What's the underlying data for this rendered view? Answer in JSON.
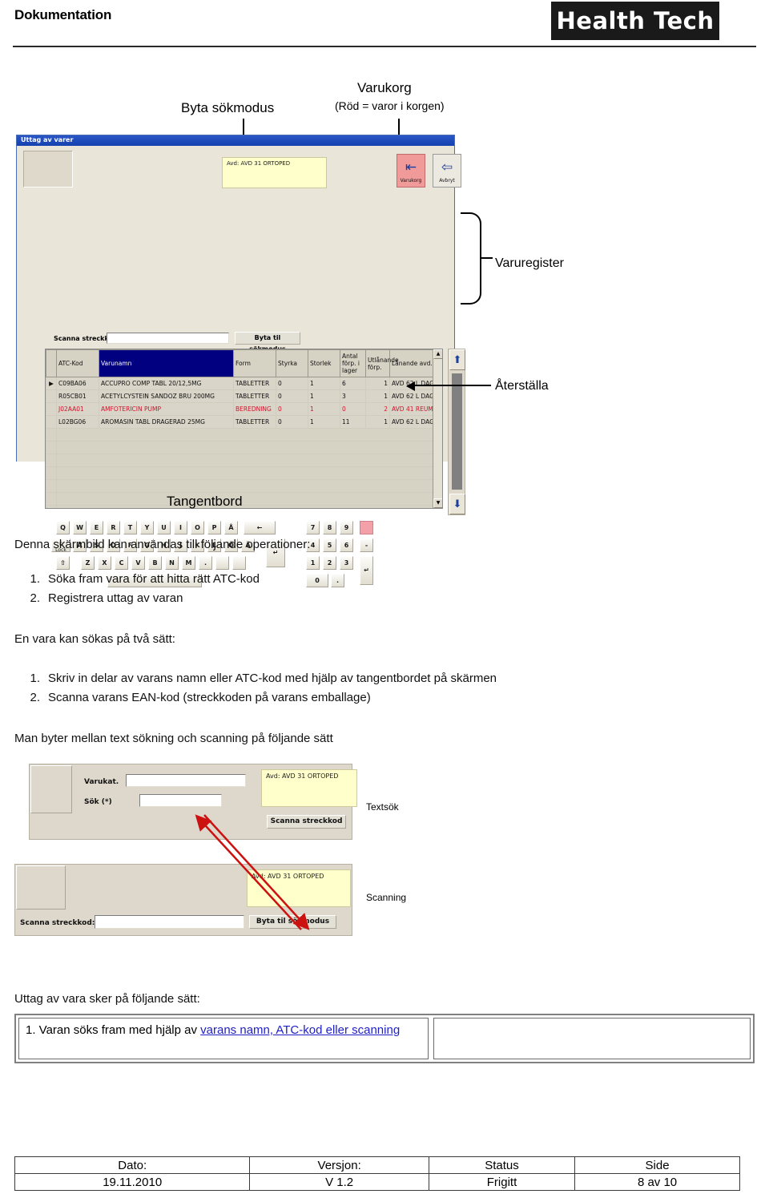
{
  "header": {
    "doc_title": "Dokumentation",
    "logo_text": "Health Tech"
  },
  "callouts": {
    "byta_sokmodus": "Byta sökmodus",
    "varukorg_line1": "Varukorg",
    "varukorg_line2": "(Röd = varor i korgen)",
    "varuregister": "Varuregister",
    "aterstalla": "Återställa",
    "tangentbord": "Tangentbord",
    "textsok": "Textsök",
    "scanning": "Scanning"
  },
  "app": {
    "window_title": "Uttag av varer",
    "avd_box": "Avd: AVD 31 ORTOPED",
    "toolbar": [
      {
        "label": "Varukorg",
        "glyph": "⇤",
        "highlight_color": "#f09a9a"
      },
      {
        "label": "Avbryt",
        "glyph": "⇦",
        "highlight_color": "#ece9e0"
      }
    ],
    "scan_label": "Scanna streckkod:",
    "scan_value": "",
    "switch_mode_button": "Byta til sökmodus",
    "grid": {
      "columns": [
        "",
        "ATC-Kod",
        "Varunamn",
        "Form",
        "Styrka",
        "Storlek",
        "Antal förp. i lager",
        "Utlånande förp.",
        "Lånande avd."
      ],
      "selected_column": "Varunamn",
      "rows": [
        {
          "marker": "▶",
          "atc": "C09BA06",
          "namn": "ACCUPRO COMP TABL 20/12,5MG",
          "form": "TABLETTER",
          "styrka": "0",
          "storlek": "1",
          "antal": "6",
          "utlan": "1",
          "avd": "AVD 62 L DAG",
          "red": false
        },
        {
          "marker": "",
          "atc": "R05CB01",
          "namn": "ACETYLCYSTEIN SANDOZ BRU 200MG",
          "form": "TABLETTER",
          "styrka": "0",
          "storlek": "1",
          "antal": "3",
          "utlan": "1",
          "avd": "AVD 62 L DAG",
          "red": false
        },
        {
          "marker": "",
          "atc": "J02AA01",
          "namn": "AMFOTERICIN PUMP",
          "form": "BEREDNING",
          "styrka": "0",
          "storlek": "1",
          "antal": "0",
          "utlan": "2",
          "avd": "AVD 41 REUM",
          "red": true
        },
        {
          "marker": "",
          "atc": "L02BG06",
          "namn": "AROMASIN TABL DRAGERAD 25MG",
          "form": "TABLETTER",
          "styrka": "0",
          "storlek": "1",
          "antal": "11",
          "utlan": "1",
          "avd": "AVD 62 L DAG",
          "red": false
        }
      ]
    },
    "keyboard": {
      "row1": [
        "Q",
        "W",
        "E",
        "R",
        "T",
        "Y",
        "U",
        "I",
        "O",
        "P",
        "Å"
      ],
      "backspace": "←",
      "row2_lock": "Lock",
      "row2": [
        "A",
        "S",
        "D",
        "F",
        "G",
        "H",
        "J",
        "K",
        "L",
        "Ö",
        "Ä"
      ],
      "enter": "↵",
      "row3_shift": "⇧",
      "row3": [
        "Z",
        "X",
        "C",
        "V",
        "B",
        "N",
        "M",
        ".",
        "",
        ""
      ],
      "space": "",
      "numpad_row1": [
        "7",
        "8",
        "9"
      ],
      "numpad_row2": [
        "4",
        "5",
        "6"
      ],
      "numpad_row3": [
        "1",
        "2",
        "3"
      ],
      "numpad_row4": [
        "0",
        "."
      ],
      "numpad_reset": "",
      "numpad_minus": "-",
      "numpad_enter": "↵",
      "reset_key_color": "#f4a0a8"
    }
  },
  "body": {
    "intro": "Denna skärmbild kan användas till följande operationer:",
    "list1": [
      {
        "num": "1.",
        "text": "Söka fram vara för att hitta rätt ATC-kod"
      },
      {
        "num": "2.",
        "text": "Registrera uttag av varan"
      }
    ],
    "search_intro": "En vara kan sökas på två sätt:",
    "list2": [
      {
        "num": "1.",
        "text": "Skriv in delar av varans namn eller ATC-kod med hjälp av tangentbordet på skärmen"
      },
      {
        "num": "2.",
        "text": "Scanna varans EAN-kod (streckkoden på varans emballage)"
      }
    ],
    "switch_intro": "Man byter mellan text sökning och scanning på följande sätt",
    "uttag_intro": "Uttag av vara sker på följande sätt:"
  },
  "panel_textsok": {
    "varukat_label": "Varukat.",
    "varukat_value": "",
    "sok_label": "Sök (*)",
    "sok_value": "",
    "avd_box": "Avd: AVD 31 ORTOPED",
    "scan_button": "Scanna streckkod"
  },
  "panel_scanning": {
    "scan_label": "Scanna streckkod:",
    "scan_value": "",
    "avd_box": "Avd: AVD 31 ORTOPED",
    "switch_button": "Byta til sökmodus"
  },
  "content_table": {
    "left_text_before": "1. Varan söks fram med hjälp av ",
    "left_link": "varans namn, ATC-kod eller scanning",
    "right_text": ""
  },
  "footer": {
    "headers": [
      "Dato:",
      "Versjon:",
      "Status",
      "Side"
    ],
    "values": [
      "19.11.2010",
      "V 1.2",
      "Frigitt",
      "8 av 10"
    ]
  }
}
